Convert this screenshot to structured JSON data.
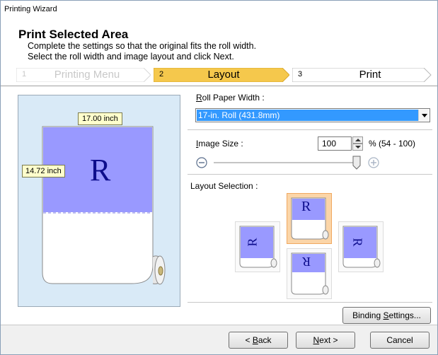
{
  "window": {
    "title": "Printing Wizard"
  },
  "header": {
    "title": "Print Selected Area",
    "desc_line1": "Complete the settings so that the original fits the roll width.",
    "desc_line2": "Select the roll width and image layout and click Next."
  },
  "steps": [
    {
      "num": "1",
      "label": "Printing Menu",
      "state": "disabled"
    },
    {
      "num": "2",
      "label": "Layout",
      "state": "active"
    },
    {
      "num": "3",
      "label": "Print",
      "state": "inactive"
    }
  ],
  "preview": {
    "width_label": "17.00 inch",
    "height_label": "14.72 inch",
    "glyph": "R"
  },
  "roll_paper": {
    "label_key": "R",
    "label_rest": "oll Paper Width :",
    "selected": "17-in. Roll (431.8mm)"
  },
  "image_size": {
    "label_key": "I",
    "label_rest": "mage Size :",
    "value": "100",
    "range": "% (54 - 100)",
    "slider_fraction": 1.0
  },
  "layout_selection": {
    "label": "Layout Selection :",
    "glyph": "R",
    "selected": "top"
  },
  "buttons": {
    "binding_pre": "Binding ",
    "binding_key": "S",
    "binding_post": "ettings...",
    "back_pre": "< ",
    "back_key": "B",
    "back_post": "ack",
    "next_key": "N",
    "next_post": "ext >",
    "cancel": "Cancel"
  },
  "colors": {
    "accent_step": "#f5c84c",
    "selection_blue": "#3399ff",
    "preview_bg": "#d9eaf7",
    "image_fill": "#9999ff",
    "selected_layout_bg": "#fbd5a8"
  }
}
